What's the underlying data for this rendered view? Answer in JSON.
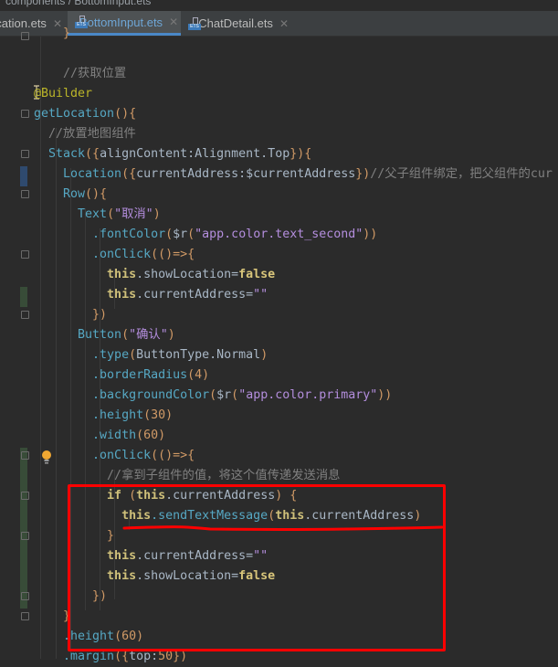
{
  "breadcrumb": "components / BottomInput.ets",
  "tabs": [
    {
      "label": "Location.ets",
      "active": false
    },
    {
      "label": "BottomInput.ets",
      "active": true
    },
    {
      "label": "ChatDetail.ets",
      "active": false
    }
  ],
  "tab_icon_label": "ETS",
  "code_lines": [
    [
      [
        "    }",
        "br"
      ]
    ],
    [],
    [
      [
        "    //获取位置",
        "cmt"
      ]
    ],
    [
      [
        "@Builder",
        "ann"
      ]
    ],
    [
      [
        "getLocation",
        "fn"
      ],
      [
        "(){",
        "br"
      ]
    ],
    [
      [
        "  //放置地图组件",
        "cmt"
      ]
    ],
    [
      [
        "  Stack",
        "fn"
      ],
      [
        "({",
        "br"
      ],
      [
        "alignContent:Alignment.Top",
        "pl"
      ],
      [
        "}){",
        "br"
      ]
    ],
    [
      [
        "    Location",
        "fn"
      ],
      [
        "({",
        "br"
      ],
      [
        "currentAddress:$currentAddress",
        "pl"
      ],
      [
        "})",
        "br"
      ],
      [
        "//父子组件绑定，把父组件的cur",
        "cmt"
      ]
    ],
    [
      [
        "    Row",
        "fn"
      ],
      [
        "(){",
        "br"
      ]
    ],
    [
      [
        "      Text",
        "fn"
      ],
      [
        "(",
        "br"
      ],
      [
        "\"取消\"",
        "str"
      ],
      [
        ")",
        "br"
      ]
    ],
    [
      [
        "        .fontColor",
        "mth"
      ],
      [
        "(",
        "br"
      ],
      [
        "$r",
        "pl"
      ],
      [
        "(",
        "br"
      ],
      [
        "\"app.color.text_second\"",
        "str"
      ],
      [
        "))",
        "br"
      ]
    ],
    [
      [
        "        .onClick",
        "mth"
      ],
      [
        "(()=>{",
        "br"
      ]
    ],
    [
      [
        "          this",
        "kw"
      ],
      [
        ".showLocation=",
        "pl"
      ],
      [
        "false",
        "lit"
      ]
    ],
    [
      [
        "          this",
        "kw"
      ],
      [
        ".currentAddress=",
        "pl"
      ],
      [
        "\"\"",
        "str"
      ]
    ],
    [
      [
        "        })",
        "br"
      ]
    ],
    [
      [
        "      Button",
        "fn"
      ],
      [
        "(",
        "br"
      ],
      [
        "\"确认\"",
        "str"
      ],
      [
        ")",
        "br"
      ]
    ],
    [
      [
        "        .type",
        "mth"
      ],
      [
        "(",
        "br"
      ],
      [
        "ButtonType.Normal",
        "pl"
      ],
      [
        ")",
        "br"
      ]
    ],
    [
      [
        "        .borderRadius",
        "mth"
      ],
      [
        "(",
        "br"
      ],
      [
        "4",
        "num"
      ],
      [
        ")",
        "br"
      ]
    ],
    [
      [
        "        .backgroundColor",
        "mth"
      ],
      [
        "(",
        "br"
      ],
      [
        "$r",
        "pl"
      ],
      [
        "(",
        "br"
      ],
      [
        "\"app.color.primary\"",
        "str"
      ],
      [
        "))",
        "br"
      ]
    ],
    [
      [
        "        .height",
        "mth"
      ],
      [
        "(",
        "br"
      ],
      [
        "30",
        "num"
      ],
      [
        ")",
        "br"
      ]
    ],
    [
      [
        "        .width",
        "mth"
      ],
      [
        "(",
        "br"
      ],
      [
        "60",
        "num"
      ],
      [
        ")",
        "br"
      ]
    ],
    [
      [
        "        .onClick",
        "mth"
      ],
      [
        "(()=>{",
        "br"
      ]
    ],
    [
      [
        "          //拿到子组件的值，将这个值传递发送消息",
        "cmt"
      ]
    ],
    [
      [
        "          if ",
        "kw"
      ],
      [
        "(",
        "br"
      ],
      [
        "this",
        "kw"
      ],
      [
        ".currentAddress",
        "pl"
      ],
      [
        ") {",
        "br"
      ]
    ],
    [
      [
        "            this",
        "kw"
      ],
      [
        ".sendTextMessage",
        "mth"
      ],
      [
        "(",
        "br"
      ],
      [
        "this",
        "kw"
      ],
      [
        ".currentAddress",
        "pl"
      ],
      [
        ")",
        "br"
      ]
    ],
    [
      [
        "          }",
        "br"
      ]
    ],
    [
      [
        "          this",
        "kw"
      ],
      [
        ".currentAddress=",
        "pl"
      ],
      [
        "\"\"",
        "str"
      ]
    ],
    [
      [
        "          this",
        "kw"
      ],
      [
        ".showLocation=",
        "pl"
      ],
      [
        "false",
        "lit"
      ]
    ],
    [
      [
        "        })",
        "br"
      ]
    ],
    [
      [
        "    }",
        "br"
      ]
    ],
    [
      [
        "    .height",
        "mth"
      ],
      [
        "(",
        "br"
      ],
      [
        "60",
        "num"
      ],
      [
        ")",
        "br"
      ]
    ],
    [
      [
        "    .margin",
        "mth"
      ],
      [
        "({",
        "br"
      ],
      [
        "top:",
        "pl"
      ],
      [
        "50",
        "num"
      ],
      [
        "})",
        "br"
      ]
    ]
  ],
  "colors": {
    "annotation_box": "#ff0000",
    "active_tab_underline": "#4a88c7"
  }
}
